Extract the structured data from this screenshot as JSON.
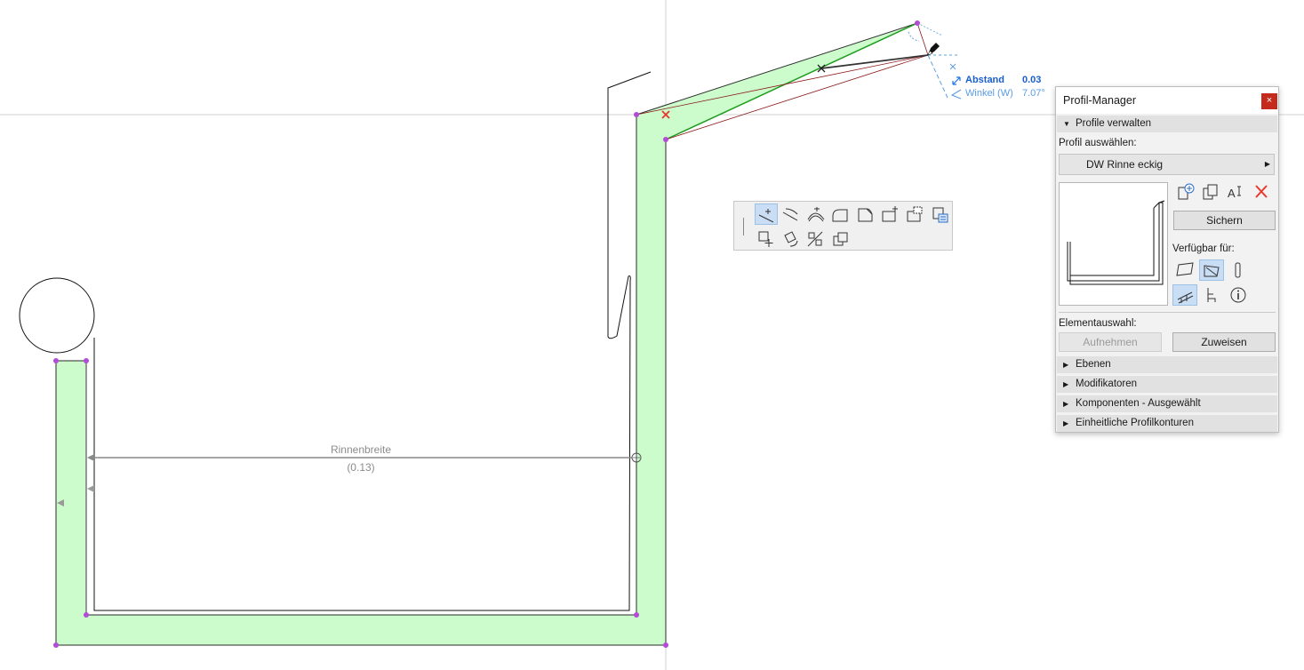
{
  "drawing": {
    "dimension_label": "Rinnenbreite",
    "dimension_value": "(0.13)"
  },
  "tracker": {
    "distance_label": "Abstand",
    "distance_value": "0.03",
    "angle_label": "Winkel (W)",
    "angle_value": "7.07°",
    "accent_color": "#1a73e8"
  },
  "pet_palette": {
    "row1_icons": [
      "add-node-icon",
      "offset-edge-icon",
      "curve-edge-icon",
      "fillet-icon",
      "chamfer-icon",
      "add-polygon-icon",
      "subtract-polygon-icon",
      "edit-profile-icon"
    ],
    "row2_icons": [
      "move-icon",
      "rotate-icon",
      "mirror-icon",
      "drag-copy-icon"
    ]
  },
  "profile_manager": {
    "title": "Profil-Manager",
    "close_label": "×",
    "sections": {
      "manage": "Profile verwalten",
      "layers": "Ebenen",
      "modifiers": "Modifikatoren",
      "components": "Komponenten - Ausgewählt",
      "contours": "Einheitliche Profilkonturen"
    },
    "select_profile_label": "Profil auswählen:",
    "selected_profile": "DW Rinne eckig",
    "save_button": "Sichern",
    "available_for_label": "Verfügbar für:",
    "element_selection_label": "Elementauswahl:",
    "pick_up_button": "Aufnehmen",
    "assign_button": "Zuweisen",
    "delete_color": "#e8372b",
    "fill_color": "#ccfbcc"
  }
}
